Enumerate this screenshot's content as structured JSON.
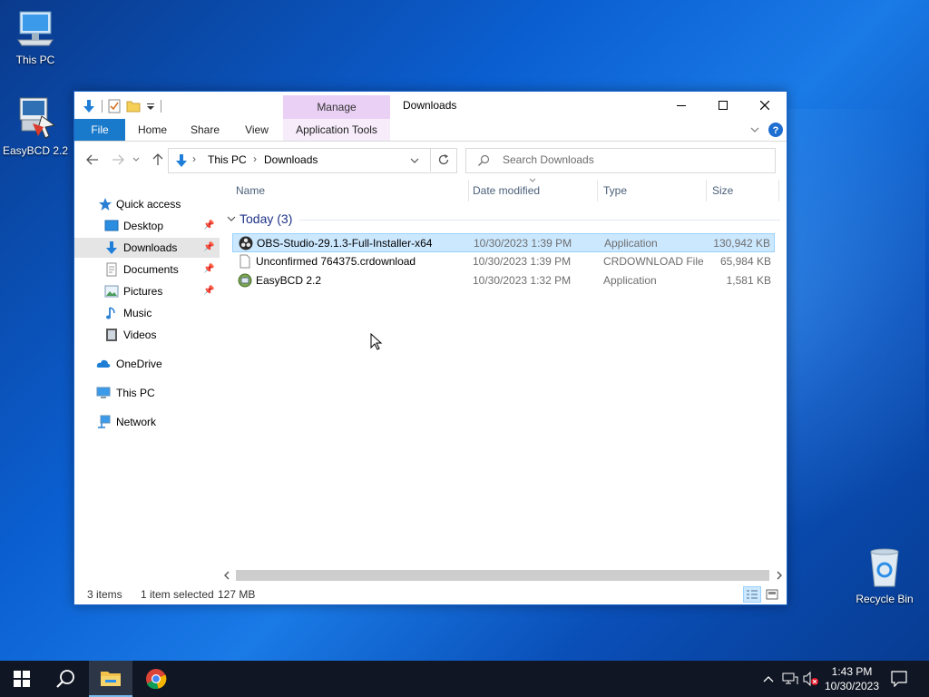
{
  "desktop": {
    "icons": [
      {
        "label": "This PC"
      },
      {
        "label": "EasyBCD 2.2"
      },
      {
        "label": "Recycle Bin"
      }
    ]
  },
  "window": {
    "title": "Downloads",
    "manage_label": "Manage",
    "ribbon_tabs": [
      "File",
      "Home",
      "Share",
      "View",
      "Application Tools"
    ],
    "breadcrumb": [
      "This PC",
      "Downloads"
    ],
    "search_placeholder": "Search Downloads",
    "nav": {
      "quick_access": "Quick access",
      "items": [
        "Desktop",
        "Downloads",
        "Documents",
        "Pictures",
        "Music",
        "Videos"
      ],
      "onedrive": "OneDrive",
      "this_pc": "This PC",
      "network": "Network"
    },
    "columns": [
      "Name",
      "Date modified",
      "Type",
      "Size"
    ],
    "group": "Today (3)",
    "files": [
      {
        "name": "OBS-Studio-29.1.3-Full-Installer-x64",
        "date": "10/30/2023 1:39 PM",
        "type": "Application",
        "size": "130,942 KB"
      },
      {
        "name": "Unconfirmed 764375.crdownload",
        "date": "10/30/2023 1:39 PM",
        "type": "CRDOWNLOAD File",
        "size": "65,984 KB"
      },
      {
        "name": "EasyBCD 2.2",
        "date": "10/30/2023 1:32 PM",
        "type": "Application",
        "size": "1,581 KB"
      }
    ],
    "status": {
      "items": "3 items",
      "selected": "1 item selected",
      "size": "127 MB"
    }
  },
  "taskbar": {
    "time": "1:43 PM",
    "date": "10/30/2023"
  }
}
